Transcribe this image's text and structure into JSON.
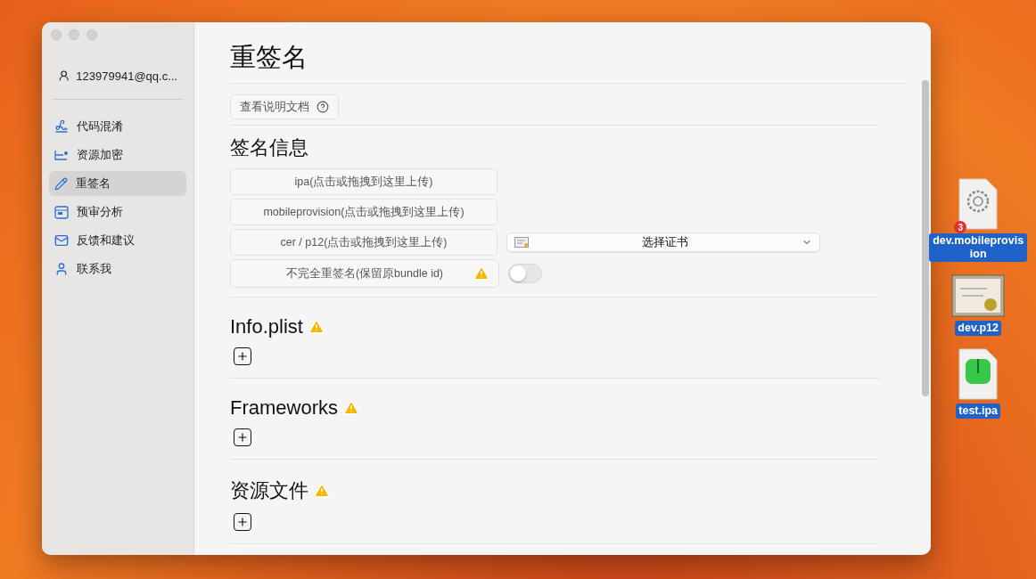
{
  "sidebar": {
    "account": "123979941@qq.c...",
    "items": [
      {
        "label": "代码混淆",
        "kind": "obfuscate",
        "selected": false
      },
      {
        "label": "资源加密",
        "kind": "encrypt",
        "selected": false
      },
      {
        "label": "重签名",
        "kind": "resign",
        "selected": true
      },
      {
        "label": "预审分析",
        "kind": "review",
        "selected": false
      },
      {
        "label": "反馈和建议",
        "kind": "feedback",
        "selected": false
      },
      {
        "label": "联系我",
        "kind": "contact",
        "selected": false
      }
    ]
  },
  "main": {
    "title": "重签名",
    "doc_button": "查看说明文档",
    "sign_info": {
      "title": "签名信息",
      "uploads": [
        "ipa(点击或拖拽到这里上传)",
        "mobileprovision(点击或拖拽到这里上传)",
        "cer / p12(点击或拖拽到这里上传)"
      ],
      "cert_select": "选择证书",
      "partial_resign": {
        "label": "不完全重签名(保留原bundle id)",
        "on": false
      }
    },
    "sections": [
      {
        "title": "Info.plist"
      },
      {
        "title": "Frameworks"
      },
      {
        "title": "资源文件"
      }
    ]
  },
  "desktop": {
    "drag_count": "3",
    "files": [
      {
        "name": "dev.mobileprovision",
        "kind": "provision",
        "selected": true
      },
      {
        "name": "dev.p12",
        "kind": "certificate",
        "selected": true
      },
      {
        "name": "test.ipa",
        "kind": "ipa",
        "selected": true
      }
    ]
  }
}
